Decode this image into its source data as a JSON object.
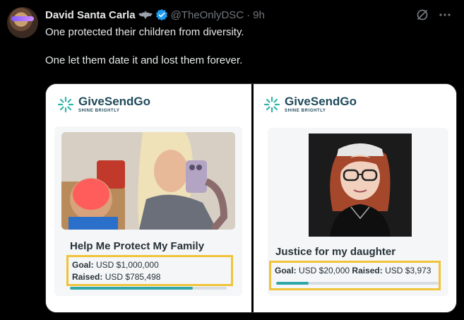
{
  "tweet": {
    "author_name": "David Santa Carla",
    "handle": "@TheOnlyDSC",
    "separator": "·",
    "time": "9h",
    "text_line1": "One protected their children from diversity.",
    "text_line2": "One let them date it and lost them forever."
  },
  "icons": {
    "bat": "bat-emoji-icon",
    "verified": "verified-badge-icon",
    "grok": "grok-icon",
    "more": "more-icon"
  },
  "colors": {
    "verified": "#1d9bf0",
    "brand": "#1f4a5a",
    "accent": "#2fa7a7",
    "highlight": "#f0c43a"
  },
  "media": {
    "left": {
      "brand_name": "GiveSendGo",
      "tagline": "SHINE BRIGHTLY",
      "title": "Help Me Protect My Family",
      "goal_label": "Goal:",
      "goal_value": "USD $1,000,000",
      "raised_label": "Raised:",
      "raised_value": "USD $785,498",
      "progress": 0.785
    },
    "right": {
      "brand_name": "GiveSendGo",
      "tagline": "SHINE BRIGHTLY",
      "title": "Justice for my daughter",
      "goal_label": "Goal:",
      "goal_value": "USD $20,000",
      "raised_label": "Raised:",
      "raised_value": "USD $3,973",
      "progress": 0.199
    }
  }
}
